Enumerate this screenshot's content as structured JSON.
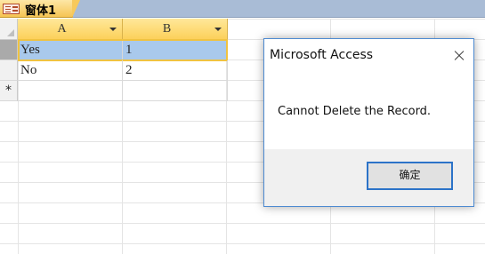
{
  "tab": {
    "label": "窗体1",
    "icon": "form-icon"
  },
  "datasheet": {
    "columns": [
      {
        "name": "A"
      },
      {
        "name": "B"
      }
    ],
    "rows": [
      {
        "a": "Yes",
        "b": "1",
        "selected": true
      },
      {
        "a": "No",
        "b": "2",
        "selected": false
      }
    ],
    "new_row_marker": "*"
  },
  "dialog": {
    "title": "Microsoft Access",
    "message": "Cannot Delete the Record.",
    "ok_label": "确定"
  },
  "colors": {
    "header_gold": "#fcd05a",
    "selected_row": "#a9c9ec",
    "dialog_border": "#4d8ad1",
    "tab_strip": "#a9bcd6"
  }
}
